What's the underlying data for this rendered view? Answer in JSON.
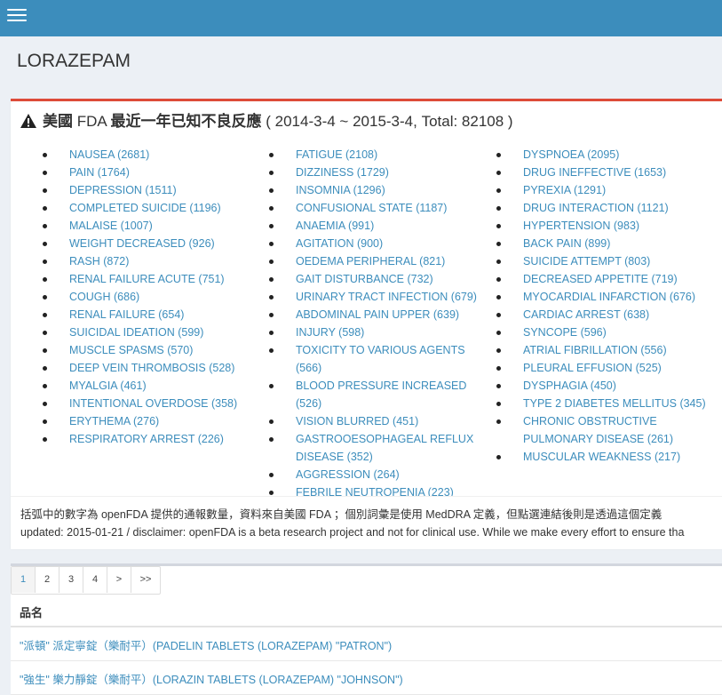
{
  "header": {
    "menu_icon": "hamburger-menu-icon"
  },
  "page": {
    "title": "LORAZEPAM"
  },
  "adverse": {
    "icon": "warning-icon",
    "title_prefix": "美國",
    "title_fda": "FDA",
    "title_main": "最近一年已知不良反應",
    "title_range": "( 2014-3-4 ~ 2015-3-4, Total: 82108 )",
    "columns": [
      [
        "NAUSEA (2681)",
        "PAIN (1764)",
        "DEPRESSION (1511)",
        "COMPLETED SUICIDE (1196)",
        "MALAISE (1007)",
        "WEIGHT DECREASED (926)",
        "RASH (872)",
        "RENAL FAILURE ACUTE (751)",
        "COUGH (686)",
        "RENAL FAILURE (654)",
        "SUICIDAL IDEATION (599)",
        "MUSCLE SPASMS (570)",
        "DEEP VEIN THROMBOSIS (528)",
        "MYALGIA (461)",
        "INTENTIONAL OVERDOSE (358)",
        "ERYTHEMA (276)",
        "RESPIRATORY ARREST (226)"
      ],
      [
        "FATIGUE (2108)",
        "DIZZINESS (1729)",
        "INSOMNIA (1296)",
        "CONFUSIONAL STATE (1187)",
        "ANAEMIA (991)",
        "AGITATION (900)",
        "OEDEMA PERIPHERAL (821)",
        "GAIT DISTURBANCE (732)",
        "URINARY TRACT INFECTION (679)",
        "ABDOMINAL PAIN UPPER (639)",
        "INJURY (598)",
        "TOXICITY TO VARIOUS AGENTS (566)",
        "BLOOD PRESSURE INCREASED (526)",
        "VISION BLURRED (451)",
        "GASTROOESOPHAGEAL REFLUX DISEASE (352)",
        "AGGRESSION (264)",
        "FEBRILE NEUTROPENIA (223)"
      ],
      [
        "DYSPNOEA (2095)",
        "DRUG INEFFECTIVE (1653)",
        "PYREXIA (1291)",
        "DRUG INTERACTION (1121)",
        "HYPERTENSION (983)",
        "BACK PAIN (899)",
        "SUICIDE ATTEMPT (803)",
        "DECREASED APPETITE (719)",
        "MYOCARDIAL INFARCTION (676)",
        "CARDIAC ARREST (638)",
        "SYNCOPE (596)",
        "ATRIAL FIBRILLATION (556)",
        "PLEURAL EFFUSION (525)",
        "DYSPHAGIA (450)",
        "TYPE 2 DIABETES MELLITUS (345)",
        "CHRONIC OBSTRUCTIVE PULMONARY DISEASE (261)",
        "MUSCULAR WEAKNESS (217)"
      ]
    ],
    "note_line1": "括弧中的數字為 openFDA 提供的通報數量，資料來自美國 FDA ；個別詞彙是使用 MedDRA 定義，但點選連結後則是透過這個定義",
    "note_line2": "updated: 2015-01-21 / disclaimer: openFDA is a beta research project and not for clinical use. While we make every effort to ensure tha"
  },
  "pagination": [
    "1",
    "2",
    "3",
    "4",
    ">",
    ">>"
  ],
  "products": {
    "header": "品名",
    "rows": [
      "\"派頓\" 派定寧錠（樂耐平）(PADELIN TABLETS (LORAZEPAM) \"PATRON\")",
      "\"強生\" 樂力靜錠（樂耐平）(LORAZIN TABLETS (LORAZEPAM) \"JOHNSON\")"
    ]
  }
}
